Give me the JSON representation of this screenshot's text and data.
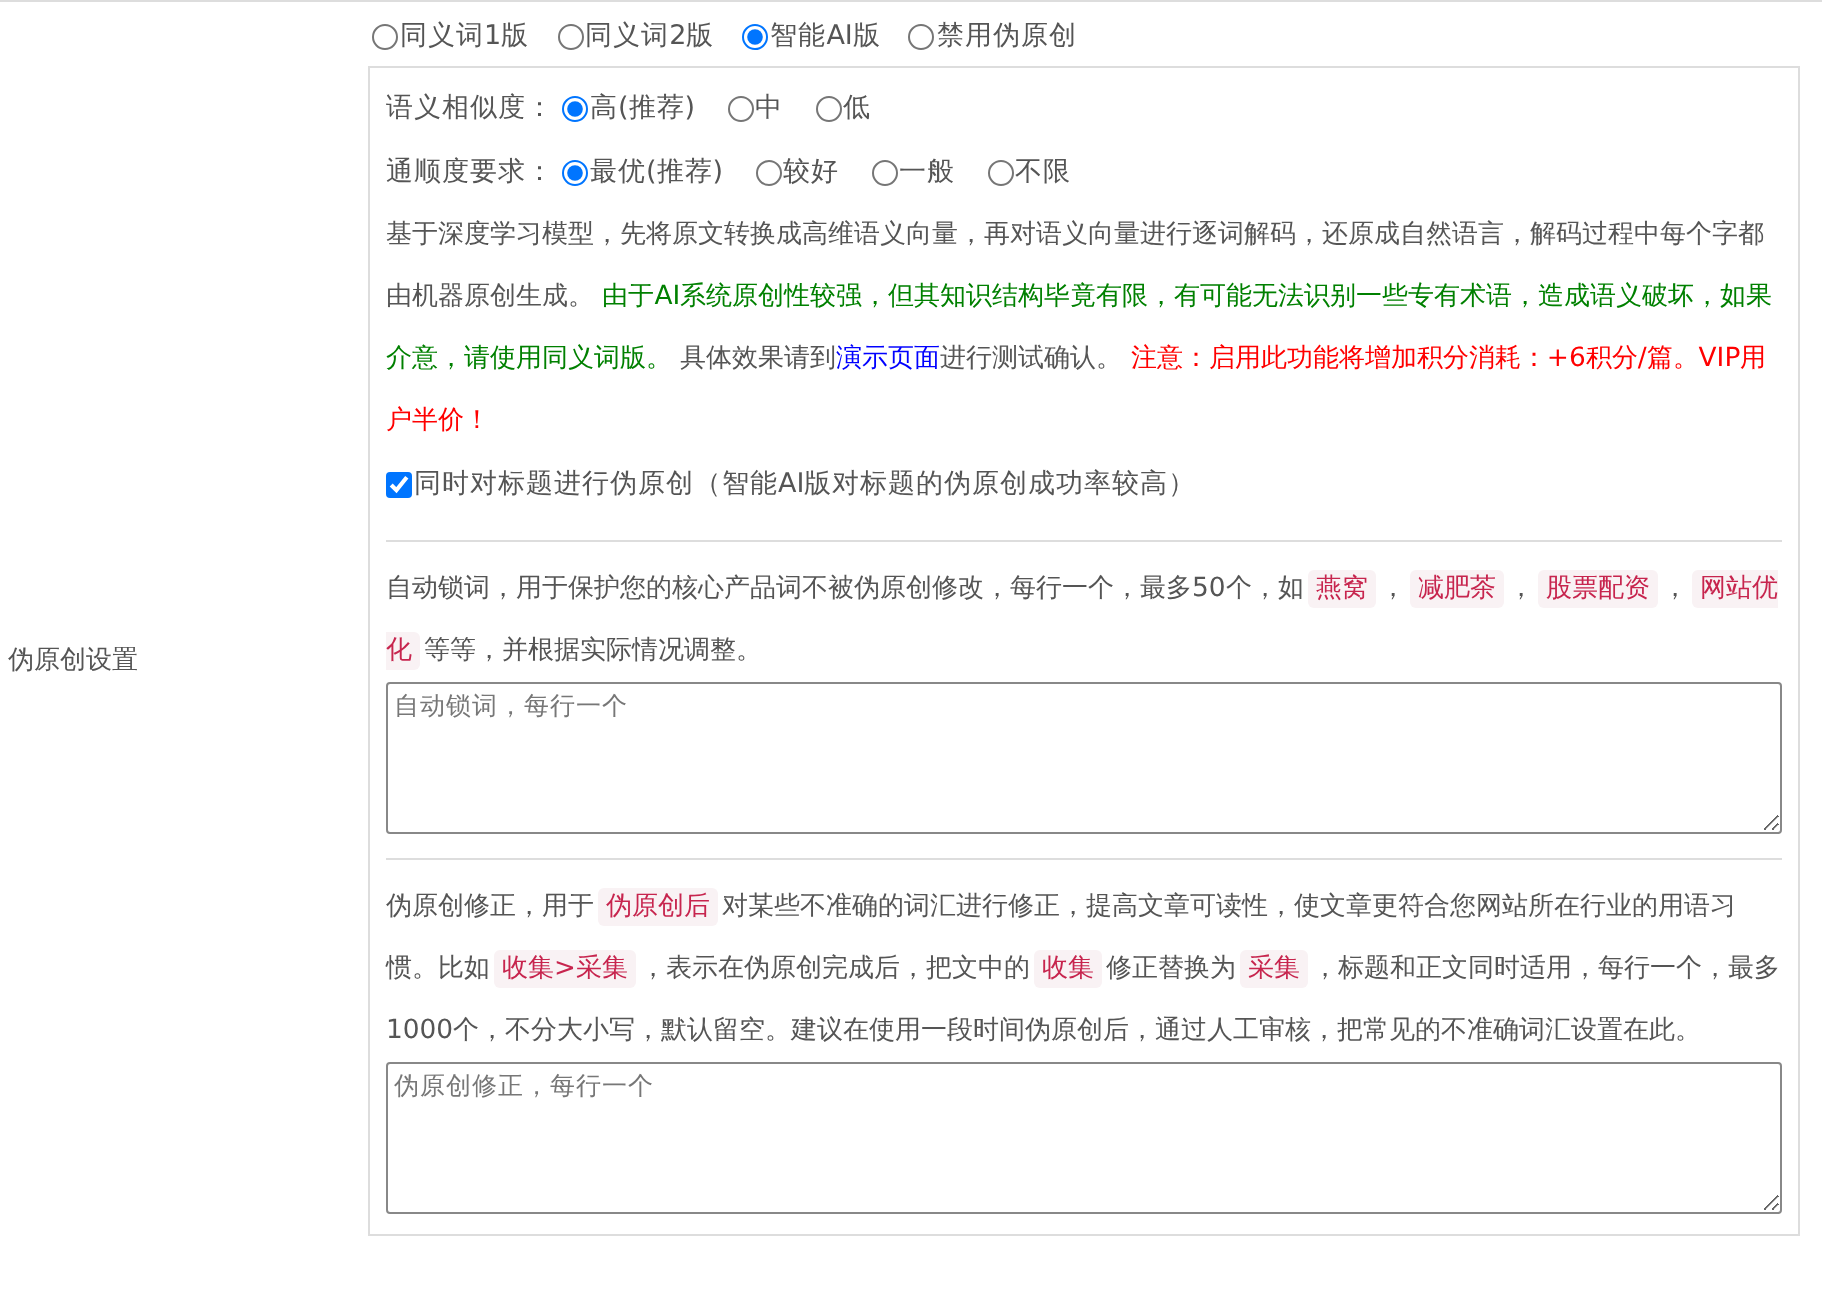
{
  "versions": [
    {
      "label": "同义词1版",
      "selected": false
    },
    {
      "label": "同义词2版",
      "selected": false
    },
    {
      "label": "智能AI版",
      "selected": true
    },
    {
      "label": "禁用伪原创",
      "selected": false
    }
  ],
  "similarity": {
    "label": "语义相似度：",
    "options": [
      {
        "label": "高(推荐)",
        "selected": true
      },
      {
        "label": "中",
        "selected": false
      },
      {
        "label": "低",
        "selected": false
      }
    ]
  },
  "fluency": {
    "label": "通顺度要求：",
    "options": [
      {
        "label": "最优(推荐)",
        "selected": true
      },
      {
        "label": "较好",
        "selected": false
      },
      {
        "label": "一般",
        "selected": false
      },
      {
        "label": "不限",
        "selected": false
      }
    ]
  },
  "description": [
    {
      "kind": "plain",
      "text": "基于深度学习模型，先将原文转换成高维语义向量，再对语义向量进行逐词解码，还原成自然语言，解码过程中每个字都由机器原创生成。 "
    },
    {
      "kind": "green",
      "text": "由于AI系统原创性较强，但其知识结构毕竟有限，有可能无法识别一些专有术语，造成语义破坏，如果介意，请使用同义词版。"
    },
    {
      "kind": "plain",
      "text": " 具体效果请到"
    },
    {
      "kind": "link",
      "text": "演示页面"
    },
    {
      "kind": "plain",
      "text": "进行测试确认。 "
    },
    {
      "kind": "red",
      "text": "注意：启用此功能将增加积分消耗：+6积分/篇。VIP用户半价！"
    }
  ],
  "title_checkbox": {
    "label": "同时对标题进行伪原创（智能AI版对标题的伪原创成功率较高）",
    "checked": true
  },
  "side_label": "伪原创设置",
  "lock_words": {
    "intro": [
      {
        "kind": "text",
        "text": "自动锁词，用于保护您的核心产品词不被伪原创修改，每行一个，最多50个，如"
      },
      {
        "kind": "tag",
        "text": "燕窝"
      },
      {
        "kind": "text",
        "text": "，"
      },
      {
        "kind": "tag",
        "text": "减肥茶"
      },
      {
        "kind": "text",
        "text": "，"
      },
      {
        "kind": "tag",
        "text": "股票配资"
      },
      {
        "kind": "text",
        "text": "，"
      },
      {
        "kind": "tag",
        "text": "网站优化"
      },
      {
        "kind": "text",
        "text": "等等，并根据实际情况调整。"
      }
    ],
    "placeholder": "自动锁词，每行一个"
  },
  "correction": {
    "intro": [
      {
        "kind": "text",
        "text": "伪原创修正，用于"
      },
      {
        "kind": "tag",
        "text": "伪原创后"
      },
      {
        "kind": "text",
        "text": "对某些不准确的词汇进行修正，提高文章可读性，使文章更符合您网站所在行业的用语习惯。比如"
      },
      {
        "kind": "tag",
        "text": "收集>采集"
      },
      {
        "kind": "text",
        "text": "，表示在伪原创完成后，把文中的"
      },
      {
        "kind": "tag",
        "text": "收集"
      },
      {
        "kind": "text",
        "text": "修正替换为"
      },
      {
        "kind": "tag",
        "text": "采集"
      },
      {
        "kind": "text",
        "text": "，标题和正文同时适用，每行一个，最多1000个，不分大小写，默认留空。建议在使用一段时间伪原创后，通过人工审核，把常见的不准确词汇设置在此。"
      }
    ],
    "placeholder": "伪原创修正，每行一个"
  }
}
